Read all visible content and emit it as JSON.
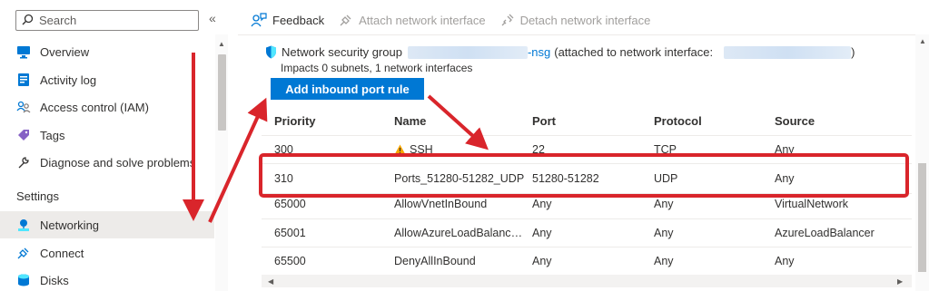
{
  "search": {
    "label": "Search"
  },
  "collapse_label": "«",
  "nav": {
    "items": [
      {
        "label": "Overview"
      },
      {
        "label": "Activity log"
      },
      {
        "label": "Access control (IAM)"
      },
      {
        "label": "Tags"
      },
      {
        "label": "Diagnose and solve problems"
      }
    ],
    "settings_title": "Settings",
    "settings_items": [
      {
        "label": "Networking",
        "selected": true
      },
      {
        "label": "Connect"
      },
      {
        "label": "Disks"
      }
    ]
  },
  "toolbar": {
    "feedback": "Feedback",
    "attach": "Attach network interface",
    "detach": "Detach network interface"
  },
  "nsg": {
    "prefix": "Network security group",
    "suffix": "-nsg",
    "attached_text": "(attached to network interface:",
    "close_paren": ")",
    "impacts": "Impacts 0 subnets, 1 network interfaces",
    "add_rule": "Add inbound port rule"
  },
  "table": {
    "headers": [
      "Priority",
      "Name",
      "Port",
      "Protocol",
      "Source"
    ],
    "rows": [
      {
        "priority": "300",
        "name": "SSH",
        "port": "22",
        "protocol": "TCP",
        "source": "Any",
        "warning": true
      },
      {
        "priority": "310",
        "name": "Ports_51280-51282_UDP",
        "port": "51280-51282",
        "protocol": "UDP",
        "source": "Any",
        "highlighted": true
      },
      {
        "priority": "65000",
        "name": "AllowVnetInBound",
        "port": "Any",
        "protocol": "Any",
        "source": "VirtualNetwork"
      },
      {
        "priority": "65001",
        "name": "AllowAzureLoadBalance...",
        "port": "Any",
        "protocol": "Any",
        "source": "AzureLoadBalancer"
      },
      {
        "priority": "65500",
        "name": "DenyAllInBound",
        "port": "Any",
        "protocol": "Any",
        "source": "Any"
      }
    ]
  },
  "colors": {
    "accent": "#0078d4",
    "annotation": "#d9252b",
    "selected_bg": "#edebe9",
    "warning": "#f7a600"
  }
}
